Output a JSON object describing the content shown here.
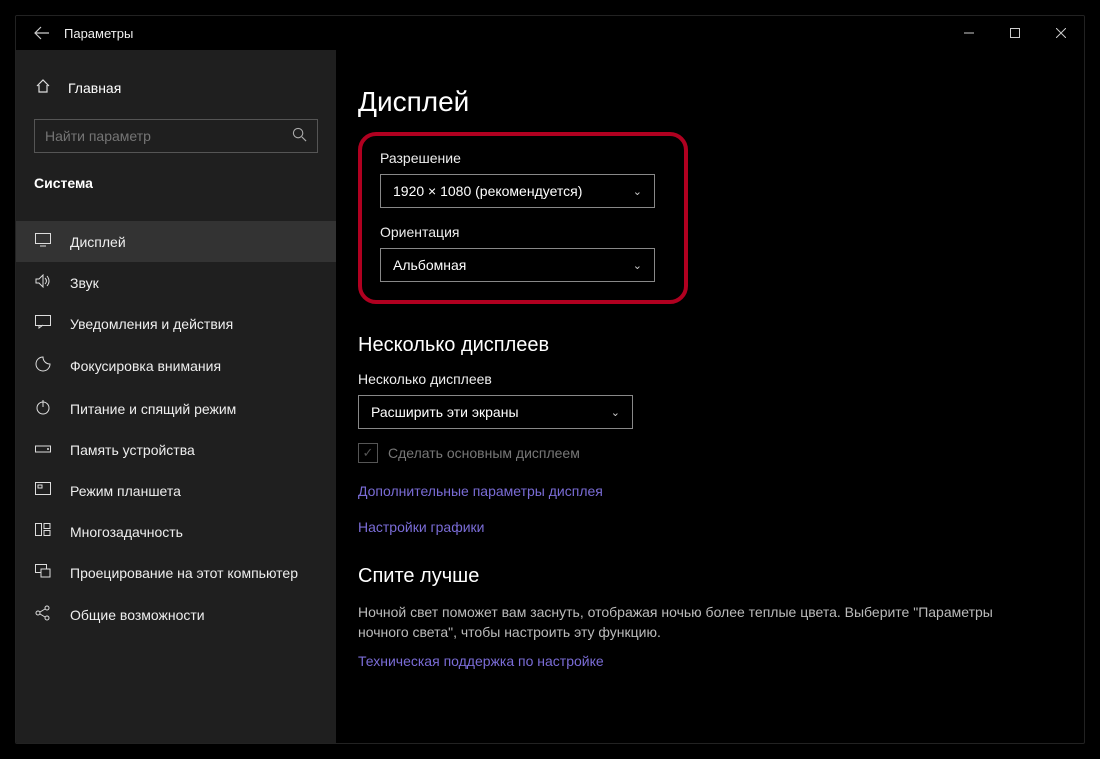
{
  "window": {
    "title": "Параметры"
  },
  "sidebar": {
    "home": "Главная",
    "search_placeholder": "Найти параметр",
    "section": "Система",
    "items": [
      {
        "label": "Дисплей"
      },
      {
        "label": "Звук"
      },
      {
        "label": "Уведомления и действия"
      },
      {
        "label": "Фокусировка внимания"
      },
      {
        "label": "Питание и спящий режим"
      },
      {
        "label": "Память устройства"
      },
      {
        "label": "Режим планшета"
      },
      {
        "label": "Многозадачность"
      },
      {
        "label": "Проецирование на этот компьютер"
      },
      {
        "label": "Общие возможности"
      }
    ]
  },
  "main": {
    "title": "Дисплей",
    "resolution_label": "Разрешение",
    "resolution_value": "1920 × 1080 (рекомендуется)",
    "orientation_label": "Ориентация",
    "orientation_value": "Альбомная",
    "multi_title": "Несколько дисплеев",
    "multi_label": "Несколько дисплеев",
    "multi_value": "Расширить эти экраны",
    "make_primary": "Сделать основным дисплеем",
    "adv_link": "Дополнительные параметры дисплея",
    "gfx_link": "Настройки графики",
    "sleep_title": "Спите лучше",
    "sleep_body": "Ночной свет поможет вам заснуть, отображая ночью более теплые цвета. Выберите \"Параметры ночного света\", чтобы настроить эту функцию.",
    "help_link": "Техническая поддержка по настройке"
  }
}
